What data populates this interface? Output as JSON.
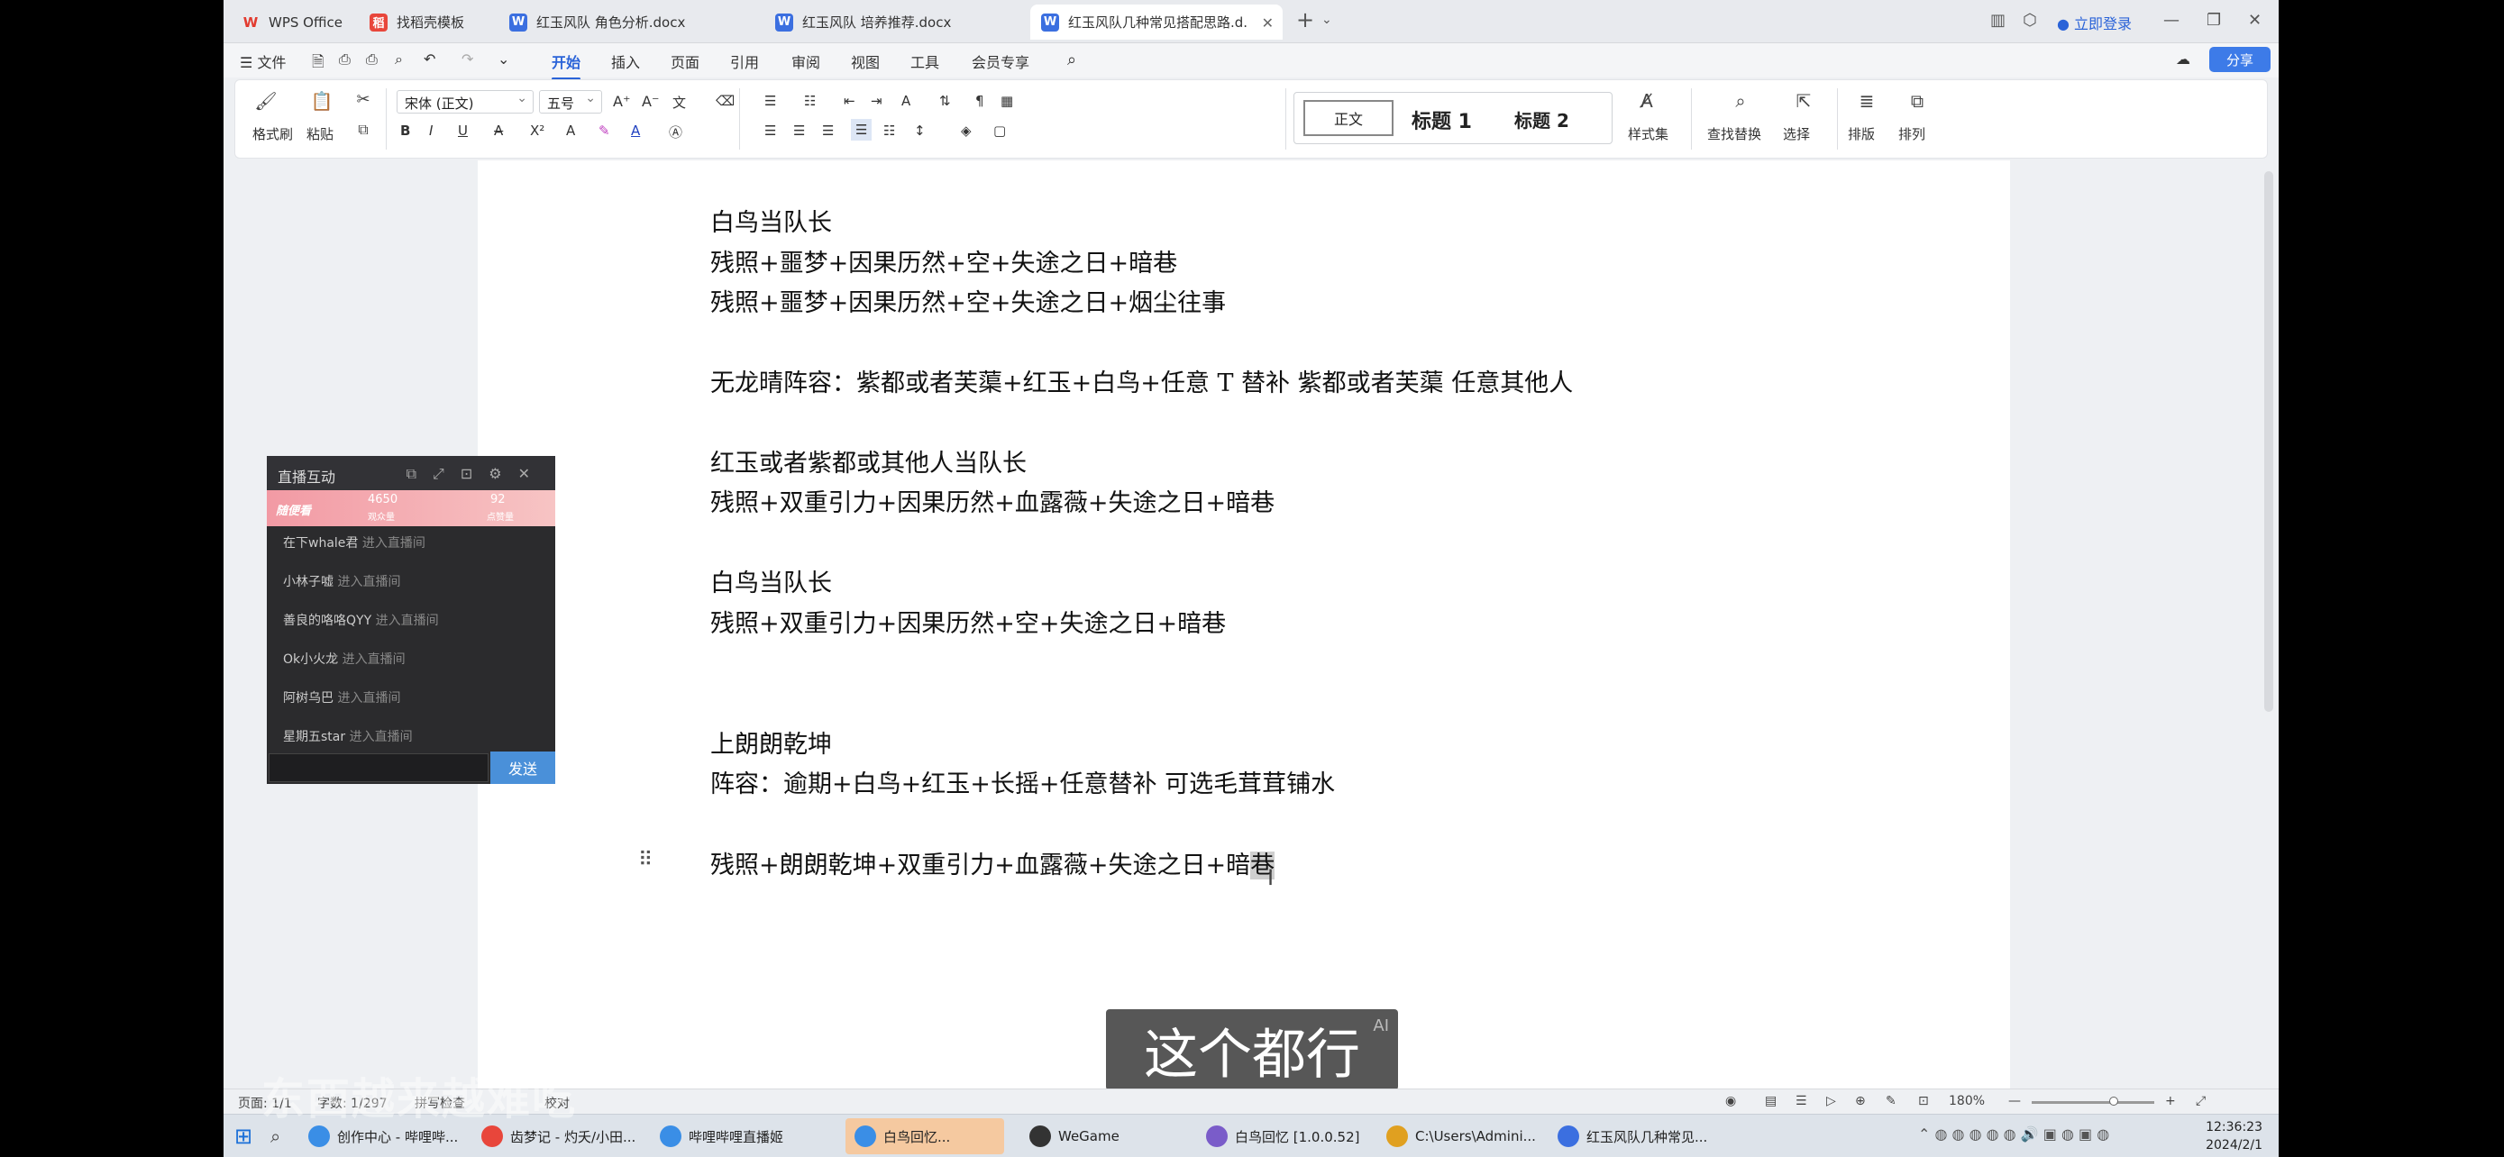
{
  "tabs": [
    {
      "label": "WPS Office",
      "icon": "wps-logo-icon"
    },
    {
      "label": "找稻壳模板",
      "icon": "template-icon"
    },
    {
      "label": "红玉风队 角色分析.docx",
      "icon": "word-doc-icon"
    },
    {
      "label": "红玉风队 培养推荐.docx",
      "icon": "word-doc-icon"
    },
    {
      "label": "红玉风队几种常见搭配思路.d...",
      "icon": "word-doc-icon",
      "active": true
    }
  ],
  "login_label": "立即登录",
  "menu": {
    "file": "文件",
    "items": [
      "开始",
      "插入",
      "页面",
      "引用",
      "审阅",
      "视图",
      "工具",
      "会员专享"
    ],
    "active": "开始",
    "share": "分享"
  },
  "ribbon": {
    "format_painter": "格式刷",
    "paste": "粘贴",
    "font": "宋体 (正文)",
    "size": "五号",
    "styles": [
      "正文",
      "标题 1",
      "标题 2"
    ],
    "style_set": "样式集",
    "find_replace": "查找替换",
    "select": "选择",
    "typeset": "排版",
    "arrange": "排列"
  },
  "document": {
    "lines": [
      "白鸟当队长",
      "残照+噩梦+因果历然+空+失途之日+暗巷",
      "残照+噩梦+因果历然+空+失途之日+烟尘往事",
      "",
      "无龙晴阵容：紫都或者芙蕖+红玉+白鸟+任意 T    替补  紫都或者芙蕖  任意其他人",
      "",
      "红玉或者紫都或其他人当队长",
      "残照+双重引力+因果历然+血露薇+失途之日+暗巷",
      "",
      "白鸟当队长",
      "残照+双重引力+因果历然+空+失途之日+暗巷",
      "",
      "",
      "上朗朗乾坤",
      "阵容：逾期+白鸟+红玉+长摇+任意替补  可选毛茸茸铺水",
      "",
      "残照+朗朗乾坤+双重引力+血露薇+失途之日+暗",
      "巷"
    ]
  },
  "live_panel": {
    "title": "直播互动",
    "stats": {
      "tag": "随便看",
      "viewers": "4650",
      "viewers_label": "观众量",
      "likes": "92",
      "likes_label": "点赞量"
    },
    "entries": [
      {
        "user": "在下whale君",
        "action": "进入直播间"
      },
      {
        "user": "小林子嘘",
        "action": "进入直播间"
      },
      {
        "user": "善良的咯咯QYY",
        "action": "进入直播间"
      },
      {
        "user": "Ok小火龙",
        "action": "进入直播间"
      },
      {
        "user": "阿树乌巴",
        "action": "进入直播间"
      },
      {
        "user": "星期五star",
        "action": "进入直播间"
      }
    ],
    "send": "发送"
  },
  "subtitle": {
    "text": "这个都行",
    "badge": "AI"
  },
  "statusbar": {
    "page": "页面: 1/1",
    "words": "字数: 1/297",
    "spell": "拼写检查",
    "proof": "校对",
    "zoom": "180%"
  },
  "taskbar": {
    "items": [
      {
        "label": "创作中心 - 哔哩哔...",
        "color": "#3a8ee6"
      },
      {
        "label": "齿梦记 - 灼夭/小田...",
        "color": "#e8463b"
      },
      {
        "label": "哔哩哔哩直播姬",
        "color": "#3a8ee6"
      },
      {
        "label": "白鸟回忆...",
        "color": "#3a8ee6",
        "active": true
      },
      {
        "label": "WeGame",
        "color": "#333333"
      },
      {
        "label": "白鸟回忆 [1.0.0.52]",
        "color": "#7a5cc9"
      },
      {
        "label": "C:\\Users\\Admini...",
        "color": "#e0a020"
      },
      {
        "label": "红玉风队几种常见...",
        "color": "#3b6fe0"
      }
    ],
    "time": "12:36:23",
    "date": "2024/2/1"
  },
  "watermark": "东西越来越难吃"
}
